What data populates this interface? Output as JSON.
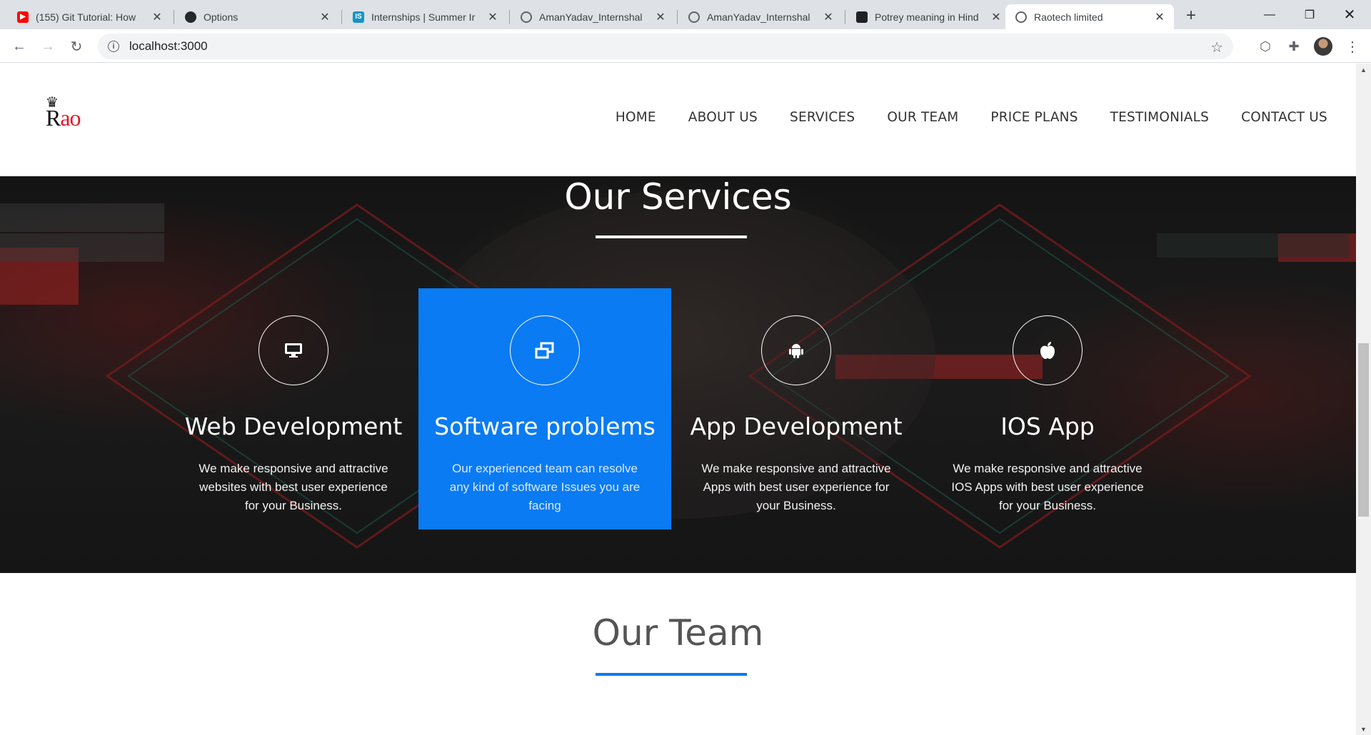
{
  "browser": {
    "tabs": [
      {
        "title": "(155) Git Tutorial: How",
        "icon": "youtube-icon"
      },
      {
        "title": "Options",
        "icon": "github-icon"
      },
      {
        "title": "Internships | Summer Ir",
        "icon": "internshala-icon"
      },
      {
        "title": "AmanYadav_Internshal",
        "icon": "globe-icon"
      },
      {
        "title": "AmanYadav_Internshal",
        "icon": "globe-icon"
      },
      {
        "title": "Potrey meaning in Hind",
        "icon": "dictionary-icon"
      },
      {
        "title": "Raotech limited",
        "icon": "globe-icon"
      }
    ],
    "url": "localhost:3000"
  },
  "site": {
    "logo": {
      "r": "R",
      "ao": "ao"
    },
    "nav": [
      "HOME",
      "ABOUT US",
      "SERVICES",
      "OUR TEAM",
      "PRICE PLANS",
      "TESTIMONIALS",
      "CONTACT US"
    ],
    "services": {
      "title": "Our Services",
      "cards": [
        {
          "icon": "monitor-icon",
          "heading": "Web Development",
          "desc": "We make responsive and attractive websites with best user experience for your Business."
        },
        {
          "icon": "windows-icon",
          "heading": "Software problems",
          "desc": "Our experienced team can resolve any kind of software Issues you are facing"
        },
        {
          "icon": "android-icon",
          "heading": "App Development",
          "desc": "We make responsive and attractive Apps with best user experience for your Business."
        },
        {
          "icon": "apple-icon",
          "heading": "IOS App",
          "desc": "We make responsive and attractive IOS Apps with best user experience for your Business."
        }
      ]
    },
    "team": {
      "title": "Our Team"
    }
  },
  "colors": {
    "accent": "#0a7bf2",
    "logo_red": "#e0162b",
    "nav_text": "#333333"
  }
}
